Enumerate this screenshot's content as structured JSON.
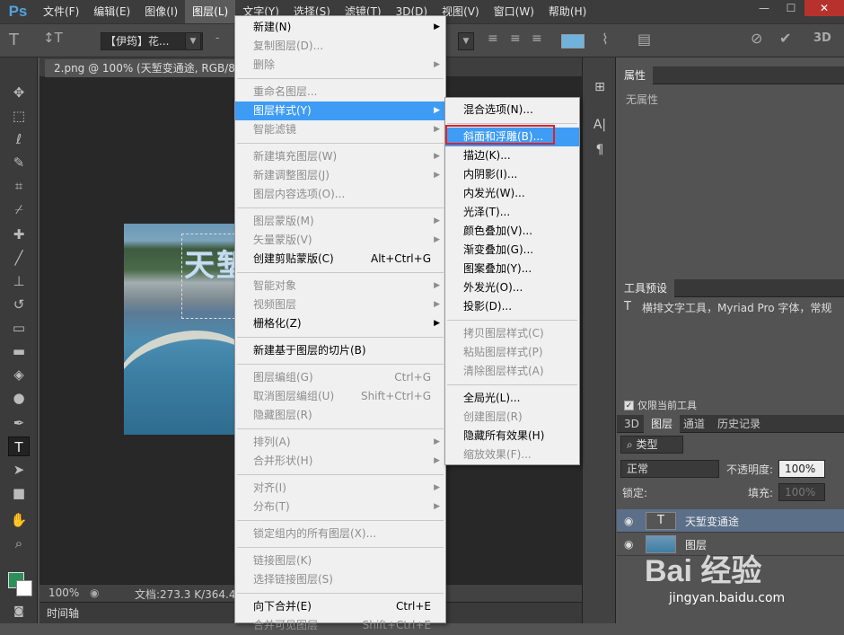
{
  "app": {
    "logo": "Ps"
  },
  "menubar": [
    "文件(F)",
    "编辑(E)",
    "图像(I)",
    "图层(L)",
    "文字(Y)",
    "选择(S)",
    "滤镜(T)",
    "3D(D)",
    "视图(V)",
    "窗口(W)",
    "帮助(H)"
  ],
  "window_controls": [
    "—",
    "☐",
    "✕"
  ],
  "options": {
    "font_family": "【伊筠】花...",
    "font_size_suffix": "-",
    "threeD": "3D"
  },
  "document": {
    "tab_title": "2.png @ 100% (天堑变通途, RGB/8) *",
    "photo_text": "天堑"
  },
  "status": {
    "zoom": "100%",
    "doc_size": "文档:273.3 K/364.4K",
    "timeline": "时间轴"
  },
  "panels": {
    "properties": {
      "tab": "属性",
      "empty_text": "无属性"
    },
    "tool_presets": {
      "tab": "工具预设",
      "item": "横排文字工具，Myriad Pro 字体，常规",
      "only_current": "仅限当前工具"
    },
    "layers": {
      "tabs": [
        "3D",
        "图层",
        "通道",
        "历史记录"
      ],
      "filter_type": "类型",
      "blend_mode": "正常",
      "opacity_label": "不透明度:",
      "opacity_value": "100%",
      "lock_label": "锁定:",
      "fill_label": "填充:",
      "fill_value": "100%",
      "rows": [
        {
          "name": "天堑变通途",
          "thumb": "T",
          "selected": true
        },
        {
          "name": "图层",
          "thumb": "",
          "selected": false
        }
      ]
    }
  },
  "layer_menu": [
    {
      "label": "新建(N)",
      "submenu": true
    },
    {
      "label": "复制图层(D)...",
      "disabled": true
    },
    {
      "label": "删除",
      "disabled": true,
      "submenu": true
    },
    {
      "sep": true
    },
    {
      "label": "重命名图层...",
      "disabled": true
    },
    {
      "label": "图层样式(Y)",
      "submenu": true,
      "highlight": true
    },
    {
      "label": "智能滤镜",
      "disabled": true,
      "submenu": true
    },
    {
      "sep": true
    },
    {
      "label": "新建填充图层(W)",
      "disabled": true,
      "submenu": true
    },
    {
      "label": "新建调整图层(J)",
      "disabled": true,
      "submenu": true
    },
    {
      "label": "图层内容选项(O)...",
      "disabled": true
    },
    {
      "sep": true
    },
    {
      "label": "图层蒙版(M)",
      "disabled": true,
      "submenu": true
    },
    {
      "label": "矢量蒙版(V)",
      "disabled": true,
      "submenu": true
    },
    {
      "label": "创建剪贴蒙版(C)",
      "shortcut": "Alt+Ctrl+G"
    },
    {
      "sep": true
    },
    {
      "label": "智能对象",
      "disabled": true,
      "submenu": true
    },
    {
      "label": "视频图层",
      "disabled": true,
      "submenu": true
    },
    {
      "label": "栅格化(Z)",
      "submenu": true
    },
    {
      "sep": true
    },
    {
      "label": "新建基于图层的切片(B)"
    },
    {
      "sep": true
    },
    {
      "label": "图层编组(G)",
      "disabled": true,
      "shortcut": "Ctrl+G"
    },
    {
      "label": "取消图层编组(U)",
      "disabled": true,
      "shortcut": "Shift+Ctrl+G"
    },
    {
      "label": "隐藏图层(R)",
      "disabled": true
    },
    {
      "sep": true
    },
    {
      "label": "排列(A)",
      "disabled": true,
      "submenu": true
    },
    {
      "label": "合并形状(H)",
      "disabled": true,
      "submenu": true
    },
    {
      "sep": true
    },
    {
      "label": "对齐(I)",
      "disabled": true,
      "submenu": true
    },
    {
      "label": "分布(T)",
      "disabled": true,
      "submenu": true
    },
    {
      "sep": true
    },
    {
      "label": "锁定组内的所有图层(X)...",
      "disabled": true
    },
    {
      "sep": true
    },
    {
      "label": "链接图层(K)",
      "disabled": true
    },
    {
      "label": "选择链接图层(S)",
      "disabled": true
    },
    {
      "sep": true
    },
    {
      "label": "向下合并(E)",
      "shortcut": "Ctrl+E"
    },
    {
      "label": "合并可见图层",
      "disabled": true,
      "shortcut": "Shift+Ctrl+E"
    }
  ],
  "style_submenu": [
    {
      "label": "混合选项(N)..."
    },
    {
      "sep": true
    },
    {
      "label": "斜面和浮雕(B)...",
      "highlight": true
    },
    {
      "label": "描边(K)..."
    },
    {
      "label": "内阴影(I)..."
    },
    {
      "label": "内发光(W)..."
    },
    {
      "label": "光泽(T)..."
    },
    {
      "label": "颜色叠加(V)..."
    },
    {
      "label": "渐变叠加(G)..."
    },
    {
      "label": "图案叠加(Y)..."
    },
    {
      "label": "外发光(O)..."
    },
    {
      "label": "投影(D)..."
    },
    {
      "sep": true
    },
    {
      "label": "拷贝图层样式(C)",
      "disabled": true
    },
    {
      "label": "粘贴图层样式(P)",
      "disabled": true
    },
    {
      "label": "清除图层样式(A)",
      "disabled": true
    },
    {
      "sep": true
    },
    {
      "label": "全局光(L)..."
    },
    {
      "label": "创建图层(R)",
      "disabled": true
    },
    {
      "label": "隐藏所有效果(H)"
    },
    {
      "label": "缩放效果(F)...",
      "disabled": true
    }
  ],
  "watermark": {
    "brand": "Bai  经验",
    "url": "jingyan.baidu.com"
  }
}
